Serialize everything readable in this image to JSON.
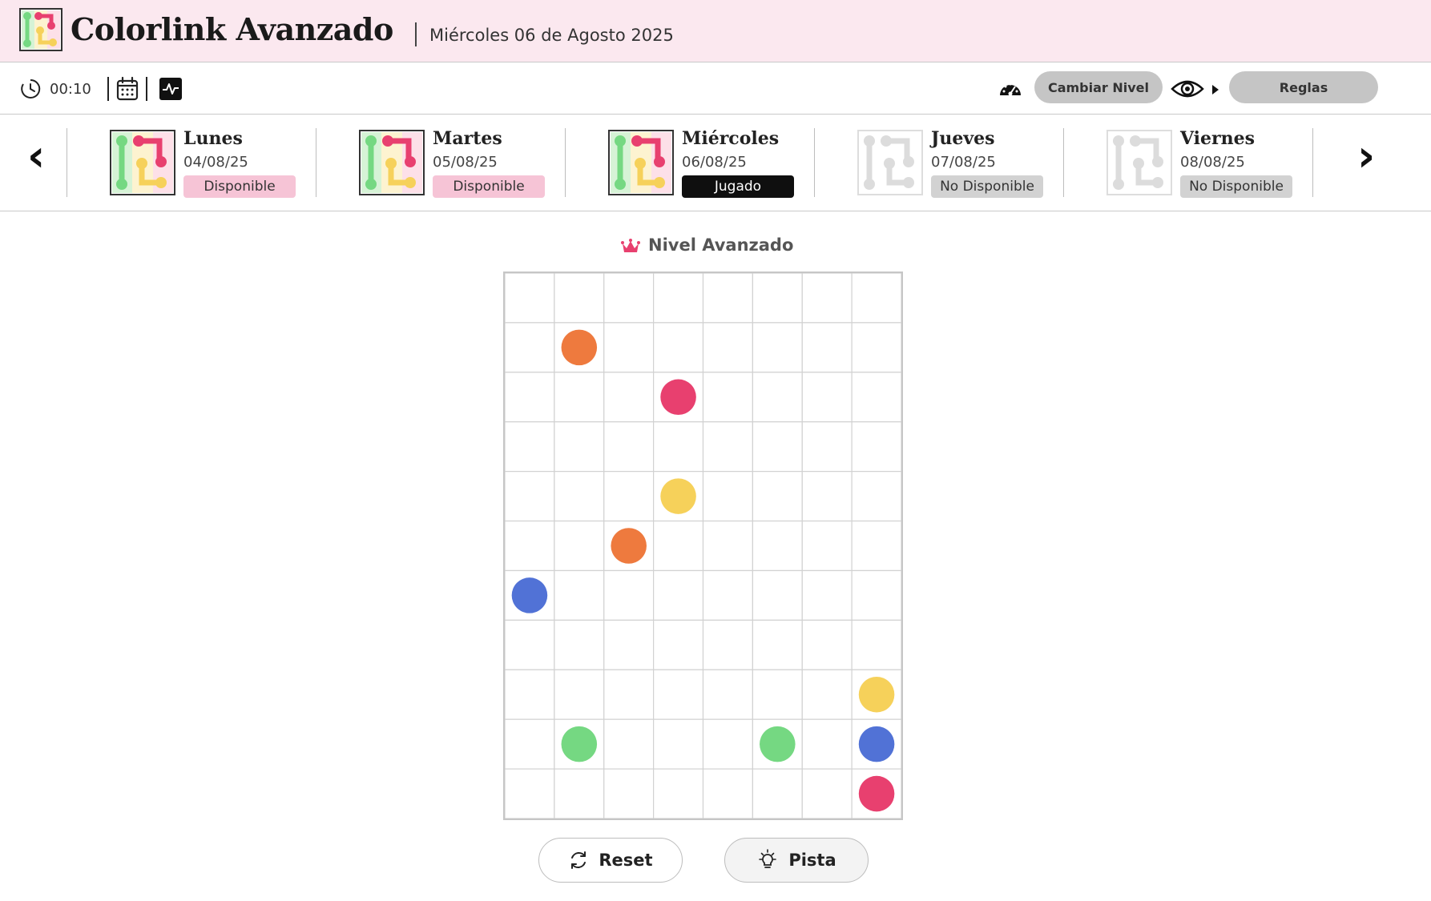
{
  "header": {
    "title": "Colorlink Avanzado",
    "date": "Miércoles 06 de Agosto 2025"
  },
  "toolbar": {
    "timer": "00:10",
    "change_level_label": "Cambiar Nivel",
    "rules_label": "Reglas"
  },
  "days": [
    {
      "name": "Lunes",
      "date": "04/08/25",
      "status": "Disponible",
      "state": "available"
    },
    {
      "name": "Martes",
      "date": "05/08/25",
      "status": "Disponible",
      "state": "available"
    },
    {
      "name": "Miércoles",
      "date": "06/08/25",
      "status": "Jugado",
      "state": "played"
    },
    {
      "name": "Jueves",
      "date": "07/08/25",
      "status": "No Disponible",
      "state": "unavailable"
    },
    {
      "name": "Viernes",
      "date": "08/08/25",
      "status": "No Disponible",
      "state": "unavailable"
    }
  ],
  "level": {
    "label": "Nivel Avanzado",
    "crown_color": "#e8406f"
  },
  "board": {
    "cols": 8,
    "rows": 11,
    "colors": {
      "orange": "#ee7a3e",
      "pink": "#e8406f",
      "yellow": "#f6d15a",
      "blue": "#5172d6",
      "green": "#75d882"
    },
    "dots": [
      {
        "color": "orange",
        "row": 1,
        "col": 1
      },
      {
        "color": "pink",
        "row": 2,
        "col": 3
      },
      {
        "color": "yellow",
        "row": 4,
        "col": 3
      },
      {
        "color": "orange",
        "row": 5,
        "col": 2
      },
      {
        "color": "blue",
        "row": 6,
        "col": 0
      },
      {
        "color": "yellow",
        "row": 8,
        "col": 7
      },
      {
        "color": "green",
        "row": 9,
        "col": 1
      },
      {
        "color": "green",
        "row": 9,
        "col": 5
      },
      {
        "color": "blue",
        "row": 9,
        "col": 7
      },
      {
        "color": "pink",
        "row": 10,
        "col": 7
      }
    ]
  },
  "actions": {
    "reset_label": "Reset",
    "hint_label": "Pista"
  },
  "icons": {
    "clock": "clock-icon",
    "calendar": "calendar-icon",
    "stats": "activity-icon",
    "speedometer": "speedometer-icon",
    "eye": "eye-icon",
    "crown": "crown-icon",
    "reset": "refresh-icon",
    "hint": "lightbulb-icon"
  }
}
